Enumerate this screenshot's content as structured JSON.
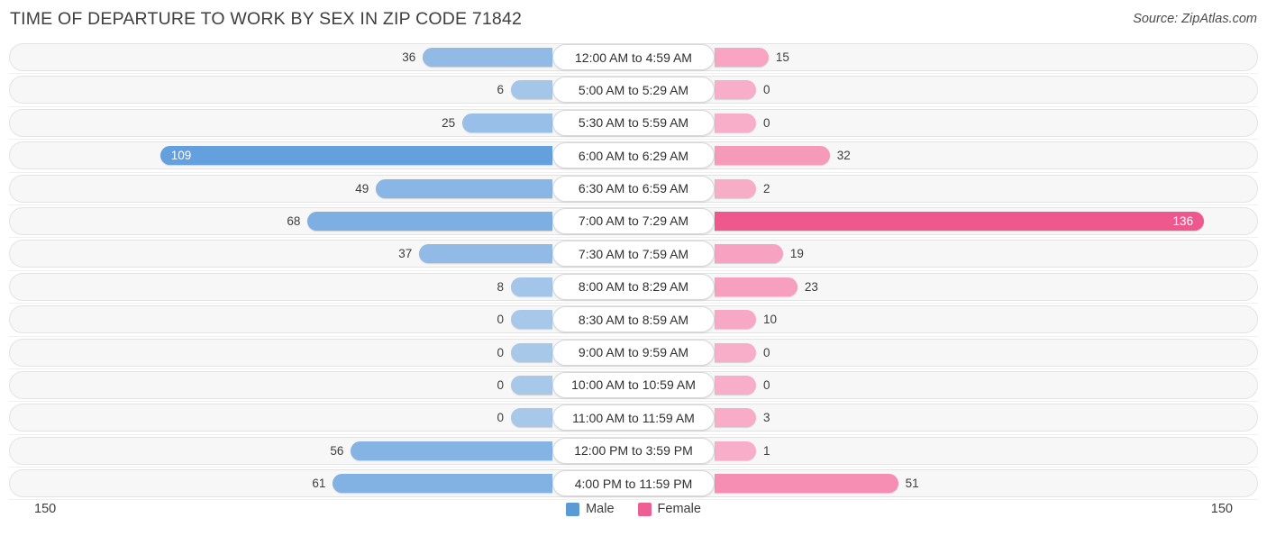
{
  "header": {
    "title": "TIME OF DEPARTURE TO WORK BY SEX IN ZIP CODE 71842",
    "source": "Source: ZipAtlas.com"
  },
  "legend": {
    "male_label": "Male",
    "female_label": "Female",
    "male_color": "#5b9bd5",
    "female_color": "#ef5e92"
  },
  "axis": {
    "left_label": "150",
    "right_label": "150",
    "max": 150
  },
  "chart_data": {
    "type": "bar",
    "title": "TIME OF DEPARTURE TO WORK BY SEX IN ZIP CODE 71842",
    "subtitle": "Source: ZipAtlas.com",
    "orientation": "horizontal-diverging",
    "xlabel": "",
    "ylabel": "",
    "xlim": [
      150,
      150
    ],
    "grid": false,
    "legend_position": "bottom-center",
    "categories": [
      "12:00 AM to 4:59 AM",
      "5:00 AM to 5:29 AM",
      "5:30 AM to 5:59 AM",
      "6:00 AM to 6:29 AM",
      "6:30 AM to 6:59 AM",
      "7:00 AM to 7:29 AM",
      "7:30 AM to 7:59 AM",
      "8:00 AM to 8:29 AM",
      "8:30 AM to 8:59 AM",
      "9:00 AM to 9:59 AM",
      "10:00 AM to 10:59 AM",
      "11:00 AM to 11:59 AM",
      "12:00 PM to 3:59 PM",
      "4:00 PM to 11:59 PM"
    ],
    "series": [
      {
        "name": "Male",
        "values": [
          36,
          6,
          25,
          109,
          49,
          68,
          37,
          8,
          0,
          0,
          0,
          0,
          56,
          61
        ]
      },
      {
        "name": "Female",
        "values": [
          15,
          0,
          0,
          32,
          2,
          136,
          19,
          23,
          10,
          0,
          0,
          3,
          1,
          51
        ]
      }
    ]
  },
  "rows": [
    {
      "label": "12:00 AM to 4:59 AM",
      "male": "36",
      "female": "15"
    },
    {
      "label": "5:00 AM to 5:29 AM",
      "male": "6",
      "female": "0"
    },
    {
      "label": "5:30 AM to 5:59 AM",
      "male": "25",
      "female": "0"
    },
    {
      "label": "6:00 AM to 6:29 AM",
      "male": "109",
      "female": "32"
    },
    {
      "label": "6:30 AM to 6:59 AM",
      "male": "49",
      "female": "2"
    },
    {
      "label": "7:00 AM to 7:29 AM",
      "male": "68",
      "female": "136"
    },
    {
      "label": "7:30 AM to 7:59 AM",
      "male": "37",
      "female": "19"
    },
    {
      "label": "8:00 AM to 8:29 AM",
      "male": "8",
      "female": "23"
    },
    {
      "label": "8:30 AM to 8:59 AM",
      "male": "0",
      "female": "10"
    },
    {
      "label": "9:00 AM to 9:59 AM",
      "male": "0",
      "female": "0"
    },
    {
      "label": "10:00 AM to 10:59 AM",
      "male": "0",
      "female": "0"
    },
    {
      "label": "11:00 AM to 11:59 AM",
      "male": "0",
      "female": "3"
    },
    {
      "label": "12:00 PM to 3:59 PM",
      "male": "56",
      "female": "1"
    },
    {
      "label": "4:00 PM to 11:59 PM",
      "male": "61",
      "female": "51"
    }
  ]
}
